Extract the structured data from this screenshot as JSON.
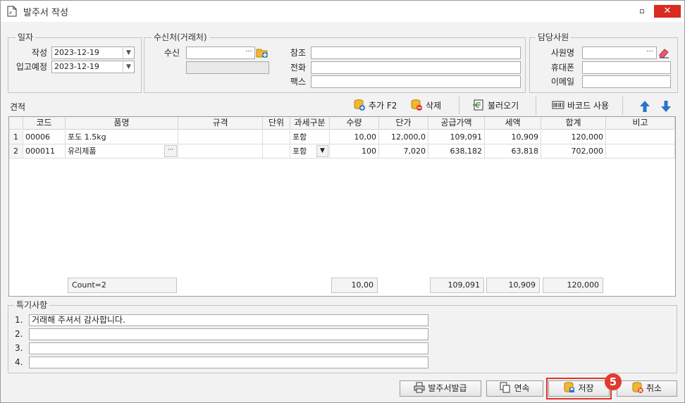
{
  "window": {
    "title": "발주서 작성",
    "minimize": "▫",
    "close": "✕"
  },
  "dates": {
    "group_title": "일자",
    "written_label": "작성",
    "written_value": "2023-12-19",
    "arrival_label": "입고예정",
    "arrival_value": "2023-12-19"
  },
  "recipient": {
    "group_title": "수신처(거래처)",
    "to_label": "수신",
    "to_value": "",
    "ellipsis": "···",
    "ref_label": "참조",
    "ref_value": "",
    "phone_label": "전화",
    "phone_value": "",
    "fax_label": "팩스",
    "fax_value": ""
  },
  "staff": {
    "group_title": "담당사원",
    "name_label": "사원명",
    "name_value": "",
    "ellipsis": "···",
    "mobile_label": "휴대폰",
    "mobile_value": "",
    "email_label": "이메일",
    "email_value": ""
  },
  "quote": {
    "label": "견적",
    "add_label": "추가 F2",
    "delete_label": "삭제",
    "load_label": "불러오기",
    "barcode_label": "바코드 사용"
  },
  "grid": {
    "columns": [
      "코드",
      "품명",
      "규격",
      "단위",
      "과세구분",
      "수량",
      "단가",
      "공급가액",
      "세액",
      "합계",
      "비고"
    ],
    "rows": [
      {
        "no": "1",
        "code": "00006",
        "name": "포도 1.5kg",
        "spec": "",
        "unit": "",
        "tax": "포함",
        "qty": "10,00",
        "price": "12,000,0",
        "supply": "109,091",
        "vat": "10,909",
        "total": "120,000",
        "note": ""
      },
      {
        "no": "2",
        "code": "000011",
        "name": "유리제품",
        "spec": "",
        "unit": "",
        "tax": "포함",
        "qty": "100",
        "price": "7,020",
        "supply": "638,182",
        "vat": "63,818",
        "total": "702,000",
        "note": ""
      }
    ],
    "row_ellipsis": "···",
    "footer": {
      "count": "Count=2",
      "qty_sum": "10,00",
      "supply_sum": "109,091",
      "vat_sum": "10,909",
      "total_sum": "120,000"
    }
  },
  "memo": {
    "group_title": "특기사항",
    "lines": [
      {
        "no": "1.",
        "text": "거래해 주셔서 감사합니다."
      },
      {
        "no": "2.",
        "text": ""
      },
      {
        "no": "3.",
        "text": ""
      },
      {
        "no": "4.",
        "text": ""
      }
    ]
  },
  "buttons": {
    "issue": "발주서발급",
    "continuous": "연속",
    "save": "저장",
    "cancel": "취소"
  },
  "annotation": {
    "step": "5"
  },
  "colors": {
    "highlight": "#e0322b",
    "close": "#d92b20",
    "arrow": "#2a74c9"
  }
}
